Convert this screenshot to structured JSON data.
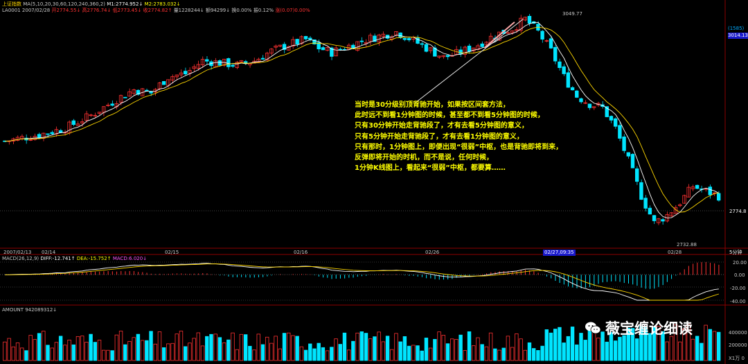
{
  "colors": {
    "up": "#ff3232",
    "down": "#00e5ff",
    "ma_white": "#ffffff",
    "ma_yellow": "#ffd700",
    "grid": "#8b0000",
    "annotation": "#ffff00",
    "badge": "#1a1acc"
  },
  "header": {
    "index_name": "上证指数",
    "ma_label": "MA(5,10,20,30,60,120,240,360,2)",
    "m1": "M1:2774.952↓",
    "m2": "M2:2783.032↓",
    "line2_code": "LA0001",
    "line2_date": "2007/02/28",
    "open": "开2774.55↓",
    "high": "高2776.74↓",
    "low": "低2773.45↓",
    "close": "收2774.82↑",
    "volume": "量1228244↓",
    "amount": "额94299↓",
    "turnover": "换0.00%",
    "amplitude": "振0.12%",
    "change": "涨(0.07)0.00%"
  },
  "main_chart": {
    "peak_label": "3049.77",
    "trough_label": "2732.88",
    "last_price_label": "2774.8",
    "right_label_top": "(1585)",
    "right_label_2": "3014.13",
    "timeframe": "5分钟"
  },
  "time_axis": {
    "start": "2007/02/13",
    "ticks": [
      "02/14",
      "02/15",
      "02/16",
      "02/26",
      "02/28"
    ],
    "highlight": "02/27,09:35"
  },
  "macd": {
    "label": "MACD(26,12,9)",
    "diff": "DIFF:-12.741↑",
    "dea": "DEA:-15.752↑",
    "macd": "MACD:6.020↓",
    "axis": [
      "20.00",
      "0.00",
      "-20.00",
      "-40.00"
    ]
  },
  "volume_panel": {
    "label": "AMOUNT 942089312↓",
    "axis": [
      "400000",
      "200000"
    ],
    "unit": "X1万 0"
  },
  "annotation": {
    "lines": [
      "当时是30分级别顶背驰开始，如果按区间套方法，",
      "此时远不到看1分钟图的时候，甚至都不到看5分钟图的时候，",
      "只有30分钟开始走背驰段了，才有去看5分钟图的意义，",
      "只有5分钟开始走背驰段了，才有去看1分钟图的意义，",
      "只有那时，1分钟图上，即便出现“很弱”中枢，也是背驰即将到来，",
      "反弹即将开始的时机，而不是说，任何时候，",
      "1分钟K线图上，看起来“很弱”中枢，都要算……"
    ]
  },
  "watermark": "薇宝缠论细读",
  "chart_data": {
    "type": "candlestick",
    "title": "上证指数",
    "timeframe": "5分钟",
    "x_ticks": [
      "2007/02/13",
      "02/14",
      "02/15",
      "02/16",
      "02/26",
      "02/27,09:35",
      "02/28"
    ],
    "price_path": [
      [
        0,
        2860
      ],
      [
        8,
        2870
      ],
      [
        14,
        2880
      ],
      [
        20,
        2900
      ],
      [
        26,
        2925
      ],
      [
        30,
        2940
      ],
      [
        34,
        2935
      ],
      [
        38,
        2960
      ],
      [
        42,
        2965
      ],
      [
        46,
        2985
      ],
      [
        50,
        2982
      ],
      [
        54,
        2978
      ],
      [
        58,
        2985
      ],
      [
        62,
        3000
      ],
      [
        66,
        3010
      ],
      [
        70,
        3018
      ],
      [
        73,
        3005
      ],
      [
        76,
        2998
      ],
      [
        80,
        3008
      ],
      [
        84,
        3018
      ],
      [
        88,
        3025
      ],
      [
        91,
        3030
      ],
      [
        94,
        3020
      ],
      [
        98,
        3005
      ],
      [
        102,
        2990
      ],
      [
        106,
        2998
      ],
      [
        110,
        3010
      ],
      [
        114,
        3025
      ],
      [
        118,
        3035
      ],
      [
        121,
        3049.77
      ],
      [
        124,
        3030
      ],
      [
        127,
        3000
      ],
      [
        130,
        2960
      ],
      [
        133,
        2930
      ],
      [
        136,
        2918
      ],
      [
        139,
        2912
      ],
      [
        142,
        2880
      ],
      [
        145,
        2830
      ],
      [
        148,
        2775
      ],
      [
        151,
        2732.88
      ],
      [
        154,
        2745
      ],
      [
        157,
        2765
      ],
      [
        160,
        2790
      ],
      [
        163,
        2782
      ],
      [
        166,
        2774.8
      ]
    ],
    "peak": 3049.77,
    "trough": 2732.88,
    "last": 2774.8,
    "macd": {
      "diff": -12.741,
      "dea": -15.752,
      "macd": 6.02,
      "ylim": [
        -40,
        20
      ],
      "ticks": [
        20,
        0,
        -20,
        -40
      ]
    },
    "amount": {
      "last": 942089312,
      "ticks": [
        400000,
        200000
      ],
      "unit": "万"
    }
  }
}
